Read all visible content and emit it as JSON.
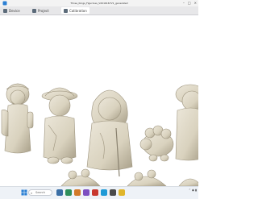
{
  "window": {
    "title": "Three_Kings_Figurines_V2016167V1_generated"
  },
  "toolbar": {
    "tabs": [
      {
        "label": "Device"
      },
      {
        "label": "Project"
      },
      {
        "label": "Calibration"
      }
    ]
  },
  "viewport": {
    "figurines": [
      {
        "name": "figurine-shepherd-left"
      },
      {
        "name": "figurine-capped-figure"
      },
      {
        "name": "figurine-mary"
      },
      {
        "name": "figurine-sheep"
      },
      {
        "name": "figurine-right-partial"
      }
    ],
    "model_color": "#d9d2be"
  },
  "taskbar": {
    "search_placeholder": "Search"
  },
  "colors": {
    "accent": "#2a7fd4",
    "toolbar_bg": "#e7e7e9",
    "model": "#d9d2be"
  }
}
